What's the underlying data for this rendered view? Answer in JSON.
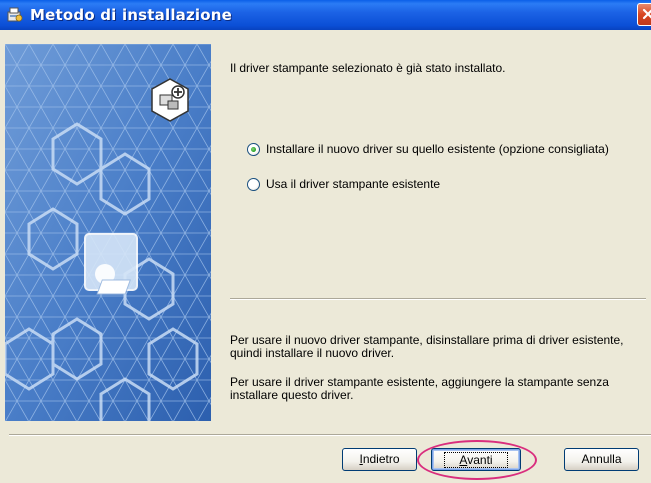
{
  "window": {
    "title": "Metodo di installazione",
    "title_icon": "installer-app-icon",
    "close_icon": "close-icon"
  },
  "side_image": {
    "description_icon": "printer-driver-illustration"
  },
  "content": {
    "message": "Il driver stampante selezionato è già stato installato.",
    "options": [
      {
        "label": "Installare il nuovo driver su quello esistente (opzione consigliata)",
        "checked": true
      },
      {
        "label": "Usa il driver stampante esistente",
        "checked": false
      }
    ],
    "info1_line1": "Per usare il nuovo driver stampante, disinstallare prima di driver esistente,",
    "info1_line2": "quindi installare il nuovo driver.",
    "info2_line1": "Per usare il driver stampante esistente, aggiungere la stampante senza",
    "info2_line2": "installare questo driver."
  },
  "buttons": {
    "back": {
      "label_prefix": "",
      "label_mnemonic": "I",
      "label_rest": "ndietro"
    },
    "next": {
      "label_prefix": "",
      "label_mnemonic": "A",
      "label_rest": "vanti"
    },
    "cancel": {
      "label": "Annulla"
    }
  },
  "colors": {
    "titlebar": "#0B4FD6",
    "dialog_bg": "#ECE9D8",
    "highlight": "#D92E7E",
    "side_bg": "#4A7EC8"
  }
}
